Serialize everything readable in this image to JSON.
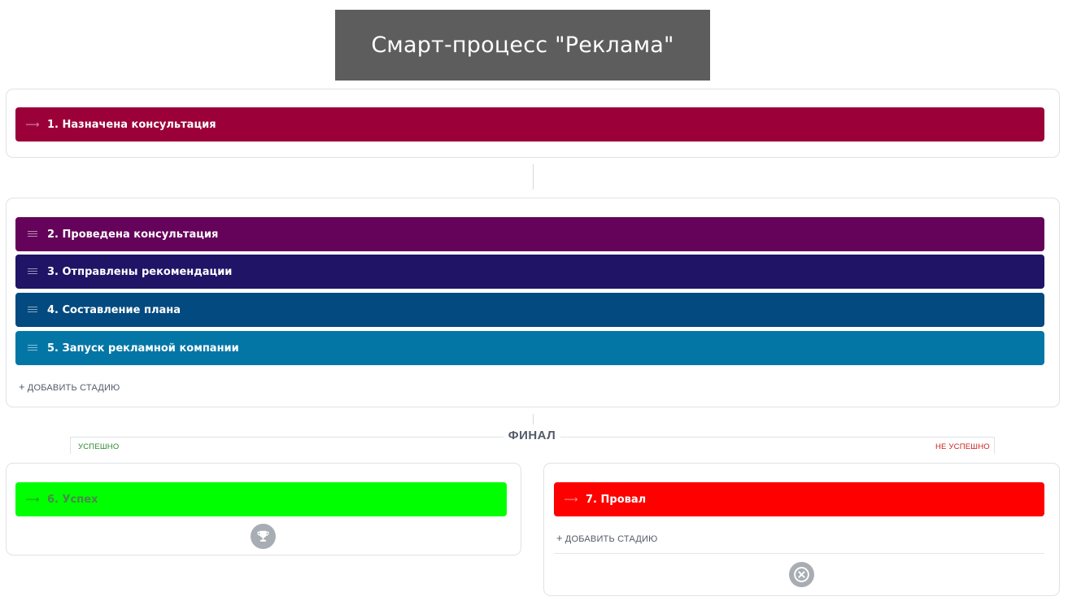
{
  "title": "Смарт-процесс \"Реклама\"",
  "stages": {
    "s1": {
      "label": "1. Назначена консультация",
      "color": "#9c0039",
      "icon": "arrow-icon"
    },
    "s2": {
      "label": "2. Проведена консультация",
      "color": "#650259",
      "icon": "drag-handle-icon"
    },
    "s3": {
      "label": "3. Отправлены рекомендации",
      "color": "#1f1466",
      "icon": "drag-handle-icon"
    },
    "s4": {
      "label": "4. Составление плана",
      "color": "#034a80",
      "icon": "drag-handle-icon"
    },
    "s5": {
      "label": "5. Запуск рекламной компании",
      "color": "#0376a6",
      "icon": "drag-handle-icon"
    },
    "s6": {
      "label": "6. Успех",
      "color": "#00ff00",
      "icon": "arrow-icon"
    },
    "s7": {
      "label": "7. Провал",
      "color": "#ff0000",
      "icon": "arrow-icon"
    }
  },
  "add_stage_label": "ДОБАВИТЬ СТАДИЮ",
  "final": {
    "label": "ФИНАЛ",
    "success_label": "УСПЕШНО",
    "fail_label": "НЕ УСПЕШНО",
    "success_color": "#2b8a2b",
    "fail_color": "#cc1f1f"
  },
  "icons": {
    "success": "trophy-icon",
    "fail": "cancel-circle-icon"
  }
}
